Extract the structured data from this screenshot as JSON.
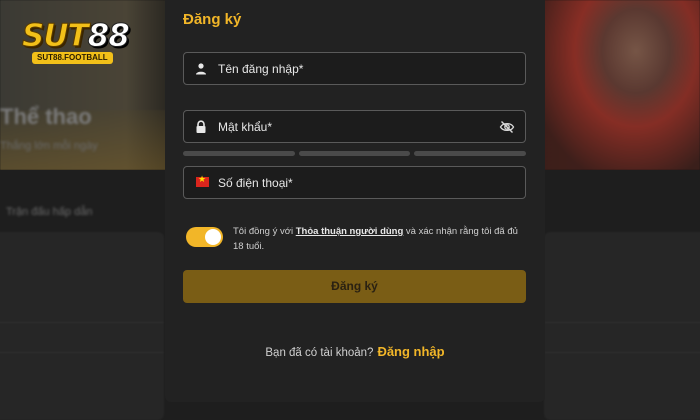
{
  "logo": {
    "brand_main": "SUT",
    "brand_num": "88",
    "tagline": "SUT88.FOOTBALL"
  },
  "background": {
    "sport_title": "Thể thao",
    "sport_subtitle": "Thắng lớn mỗi ngày",
    "section_title": "Trận đấu hấp dẫn"
  },
  "modal": {
    "title": "Đăng ký",
    "username_placeholder": "Tên đăng nhập*",
    "password_placeholder": "Mật khẩu*",
    "phone_placeholder": "Số điện thoại*",
    "agree_prefix": "Tôi đồng ý với ",
    "agree_link": "Thỏa thuận người dùng",
    "agree_suffix": "  và xác nhận rằng tôi đã đủ 18 tuổi.",
    "agree_checked": true,
    "submit_label": "Đăng ký",
    "login_prompt": "Bạn đã có tài khoản?",
    "login_link": "Đăng nhập"
  },
  "colors": {
    "accent": "#f2b628",
    "modal_bg": "#222222",
    "submit_bg": "#7a5d15",
    "field_border": "#5a5a5a"
  }
}
